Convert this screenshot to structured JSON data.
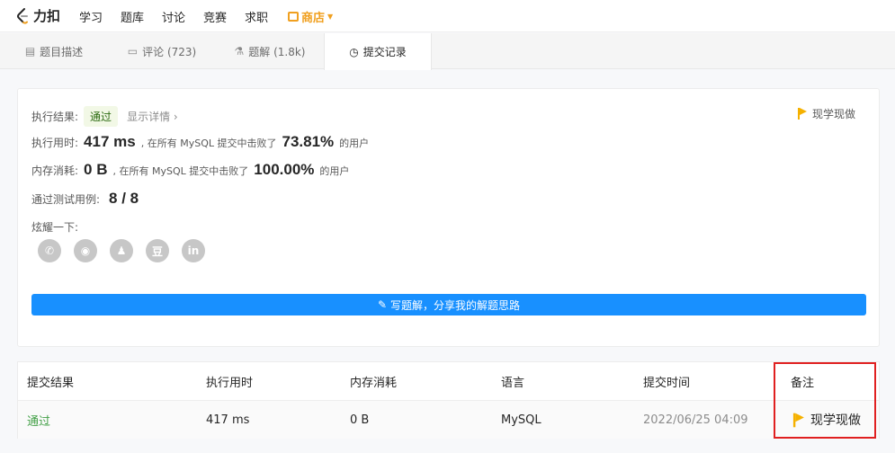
{
  "nav": {
    "logo_text": "力扣",
    "items": [
      "学习",
      "题库",
      "讨论",
      "竞赛",
      "求职"
    ],
    "store": "商店"
  },
  "tabs": [
    {
      "label": "题目描述",
      "icon": "description-icon"
    },
    {
      "label": "评论 (723)",
      "icon": "comment-icon"
    },
    {
      "label": "题解 (1.8k)",
      "icon": "flask-icon"
    },
    {
      "label": "提交记录",
      "icon": "clock-icon",
      "active": true
    }
  ],
  "result": {
    "status_label": "执行结果:",
    "status": "通过",
    "show_detail": "显示详情 ›",
    "learn_now": "现学现做",
    "runtime_label": "执行用时:",
    "runtime_value": "417 ms",
    "runtime_mid": ", 在所有 MySQL 提交中击败了",
    "runtime_pct": "73.81%",
    "runtime_tail": "的用户",
    "memory_label": "内存消耗:",
    "memory_value": "0 B",
    "memory_mid": ", 在所有 MySQL 提交中击败了",
    "memory_pct": "100.00%",
    "memory_tail": "的用户",
    "tests_label": "通过测试用例:",
    "tests_value": "8 / 8",
    "share_label": "炫耀一下:",
    "share_icons": [
      "wechat-icon",
      "weibo-icon",
      "qq-icon",
      "douban-icon",
      "linkedin-icon"
    ],
    "write_button": "写题解，分享我的解题思路"
  },
  "table": {
    "headers": [
      "提交结果",
      "执行用时",
      "内存消耗",
      "语言",
      "提交时间",
      "备注"
    ],
    "rows": [
      {
        "status": "通过",
        "runtime": "417 ms",
        "memory": "0 B",
        "language": "MySQL",
        "time": "2022/06/25 04:09",
        "note": "现学现做"
      }
    ]
  },
  "colors": {
    "accent": "#1890ff",
    "pass": "#43a047",
    "store": "#f0a020",
    "flag": "#f5b100",
    "highlight": "#e02020"
  }
}
